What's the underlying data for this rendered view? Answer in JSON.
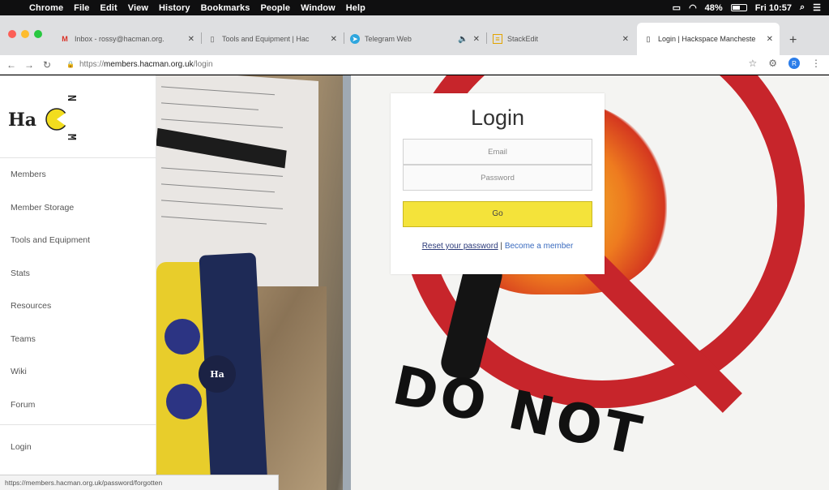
{
  "menubar": {
    "app": "Chrome",
    "items": [
      "File",
      "Edit",
      "View",
      "History",
      "Bookmarks",
      "People",
      "Window",
      "Help"
    ],
    "battery": "48%",
    "clock": "Fri 10:57"
  },
  "tabs": [
    {
      "title": "Inbox - rossy@hacman.org.",
      "icon": "gmail-icon"
    },
    {
      "title": "Tools and Equipment | Hac",
      "icon": "page-icon"
    },
    {
      "title": "Telegram Web",
      "icon": "telegram-icon"
    },
    {
      "title": "StackEdit",
      "icon": "stackedit-icon"
    },
    {
      "title": "Login | Hackspace Mancheste",
      "icon": "page-icon",
      "active": true
    }
  ],
  "toolbar": {
    "url_scheme": "https://",
    "url_host": "members.hacman.org.uk",
    "url_path": "/login"
  },
  "logo": {
    "text": "Ha",
    "letters": "MAN"
  },
  "sidebar": {
    "items": [
      "Members",
      "Member Storage",
      "Tools and Equipment",
      "Stats",
      "Resources",
      "Teams",
      "Wiki",
      "Forum"
    ],
    "login": "Login"
  },
  "login_card": {
    "title": "Login",
    "email_placeholder": "Email",
    "password_placeholder": "Password",
    "go_label": "Go",
    "reset_link": "Reset your password",
    "separator": "|",
    "become_link": "Become a member"
  },
  "photo": {
    "sign_text": "DO NOT",
    "sticker_text": "Ha"
  },
  "status_bar": "https://members.hacman.org.uk/password/forgotten",
  "colors": {
    "go_button": "#f4e33a",
    "link": "#3a6bbf",
    "sign_red": "#c7252b"
  }
}
